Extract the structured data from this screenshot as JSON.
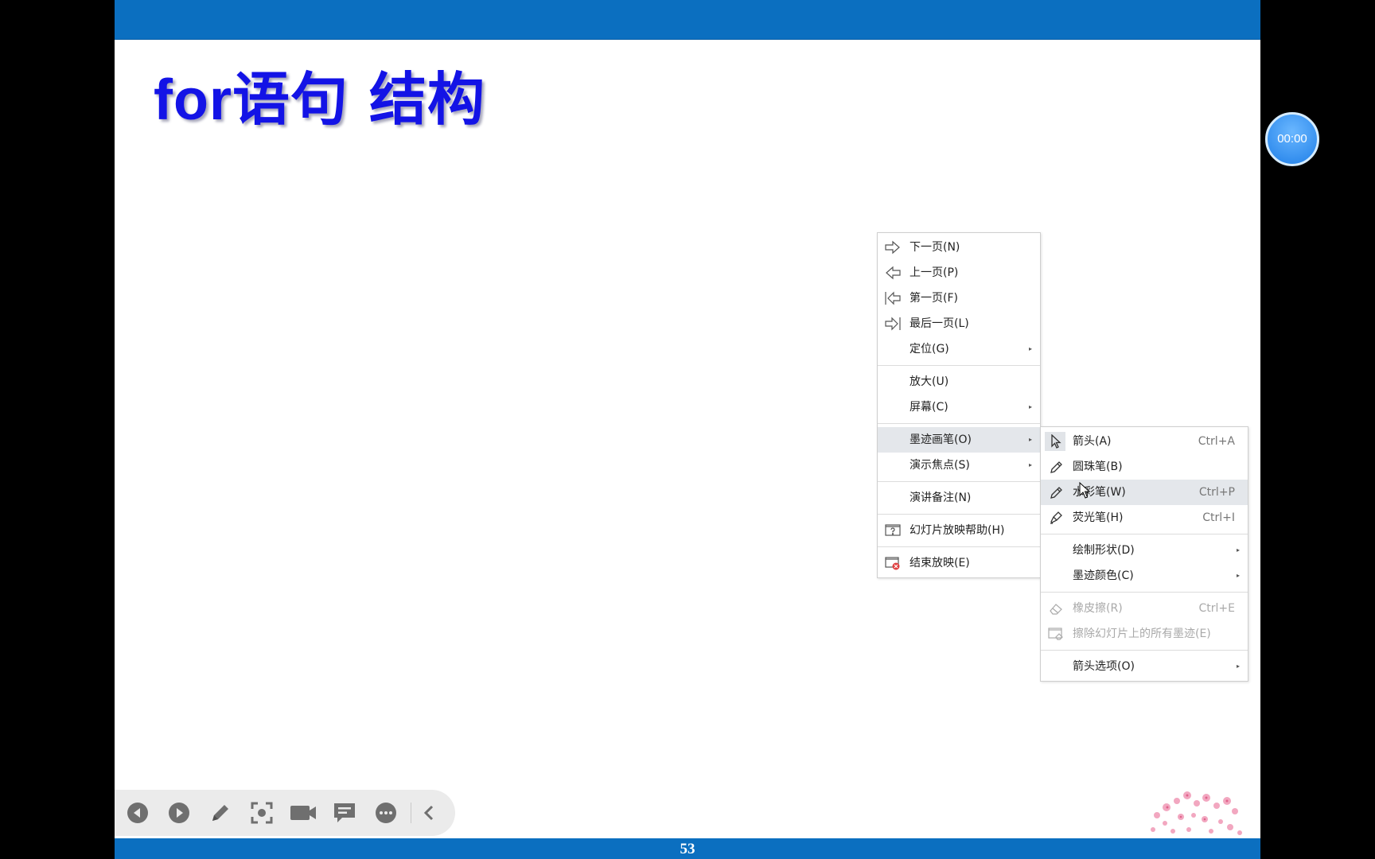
{
  "slide": {
    "title_latin": "for",
    "title_cjk": "语句 结构",
    "page_number": "53"
  },
  "timer": {
    "value": "00:00"
  },
  "toolbar": {
    "buttons": [
      "previous-icon",
      "next-icon",
      "pen-icon",
      "focus-icon",
      "camera-icon",
      "comment-icon",
      "more-icon",
      "collapse-icon"
    ]
  },
  "context_menu": {
    "items": [
      {
        "label": "下一页(N)",
        "icon": "next-arrow-icon"
      },
      {
        "label": "上一页(P)",
        "icon": "prev-arrow-icon"
      },
      {
        "label": "第一页(F)",
        "icon": "first-page-icon"
      },
      {
        "label": "最后一页(L)",
        "icon": "last-page-icon"
      },
      {
        "label": "定位(G)"
      },
      {
        "label": "放大(U)"
      },
      {
        "label": "屏幕(C)"
      },
      {
        "label": "墨迹画笔(O)"
      },
      {
        "label": "演示焦点(S)"
      },
      {
        "label": "演讲备注(N)"
      },
      {
        "label": "幻灯片放映帮助(H)",
        "icon": "help-icon"
      },
      {
        "label": "结束放映(E)",
        "icon": "end-show-icon"
      }
    ]
  },
  "ink_submenu": {
    "items": [
      {
        "label": "箭头(A)",
        "shortcut": "Ctrl+A",
        "icon": "arrow-pointer-icon"
      },
      {
        "label": "圆珠笔(B)",
        "shortcut": "",
        "icon": "ballpoint-pen-icon"
      },
      {
        "label": "水彩笔(W)",
        "shortcut": "Ctrl+P",
        "icon": "watercolor-pen-icon"
      },
      {
        "label": "荧光笔(H)",
        "shortcut": "Ctrl+I",
        "icon": "highlighter-icon"
      },
      {
        "label": "绘制形状(D)"
      },
      {
        "label": "墨迹颜色(C)"
      },
      {
        "label": "橡皮擦(R)",
        "shortcut": "Ctrl+E",
        "icon": "eraser-icon"
      },
      {
        "label": "擦除幻灯片上的所有墨迹(E)",
        "icon": "erase-all-icon"
      },
      {
        "label": "箭头选项(O)"
      }
    ]
  },
  "colors": {
    "band_blue": "#0b6fc0",
    "title_blue": "#1313e6",
    "menu_highlight": "#e4e7eb"
  }
}
